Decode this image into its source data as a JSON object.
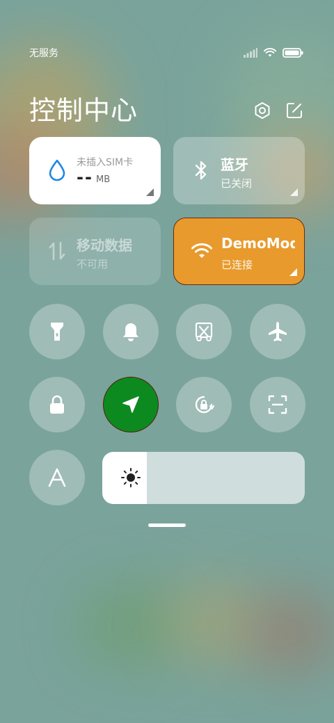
{
  "status": {
    "carrier": "无服务",
    "icons": [
      "signal-icon",
      "wifi-icon",
      "battery-icon"
    ]
  },
  "header": {
    "title": "控制中心",
    "actions": [
      "settings-icon",
      "edit-icon"
    ]
  },
  "tiles": {
    "data_usage": {
      "label": "未插入SIM卡",
      "value": "--",
      "unit": "MB",
      "icon": "water-drop-icon"
    },
    "bluetooth": {
      "label": "蓝牙",
      "status": "已关闭",
      "icon": "bluetooth-icon"
    },
    "mobile_data": {
      "label": "移动数据",
      "status": "不可用",
      "icon": "data-arrows-icon"
    },
    "wifi": {
      "label": "DemoMode",
      "status": "已连接",
      "icon": "wifi-icon",
      "color": "#e89a2c"
    }
  },
  "toggles_row1": [
    "flashlight-icon",
    "bell-icon",
    "screenshot-icon",
    "airplane-icon"
  ],
  "toggles_row2": [
    "lock-icon",
    "location-icon",
    "rotation-lock-icon",
    "scan-icon"
  ],
  "location_active_color": "#0c8a1f",
  "brightness": {
    "level": 0.22,
    "icon": "sun-icon"
  },
  "auto_text_icon": "font-size-icon"
}
